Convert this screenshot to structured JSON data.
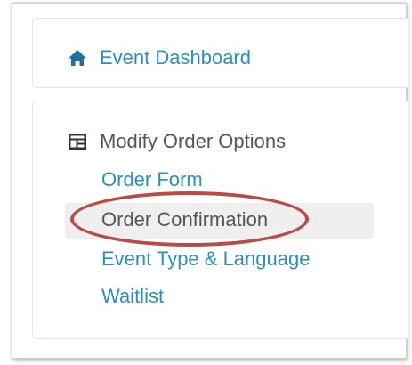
{
  "nav": {
    "home_label": "Event Dashboard",
    "home_icon": "home-icon"
  },
  "order_options": {
    "section_title": "Modify Order Options",
    "section_icon": "layout-icon",
    "items": [
      {
        "label": "Order Form",
        "selected": false
      },
      {
        "label": "Order Confirmation",
        "selected": true
      },
      {
        "label": "Event Type & Language",
        "selected": false
      },
      {
        "label": "Waitlist",
        "selected": false
      }
    ]
  },
  "colors": {
    "link": "#2a8fc0",
    "static_text": "#555555",
    "selected_bg": "#efefef",
    "highlight_ring": "#b84b46"
  }
}
